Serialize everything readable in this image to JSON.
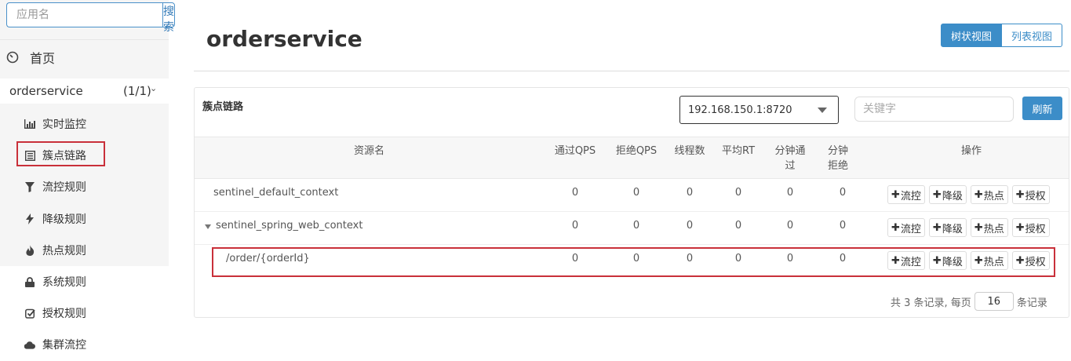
{
  "sidebar": {
    "search_placeholder": "应用名",
    "search_button": "搜索",
    "home_label": "首页",
    "app_name": "orderservice",
    "app_count": "(1/1)",
    "menu": [
      {
        "label": "实时监控",
        "icon": "bar-chart-icon"
      },
      {
        "label": "簇点链路",
        "icon": "list-icon"
      },
      {
        "label": "流控规则",
        "icon": "filter-icon"
      },
      {
        "label": "降级规则",
        "icon": "flash-icon"
      },
      {
        "label": "热点规则",
        "icon": "fire-icon"
      },
      {
        "label": "系统规则",
        "icon": "lock-icon"
      },
      {
        "label": "授权规则",
        "icon": "check-icon"
      },
      {
        "label": "集群流控",
        "icon": "cloud-icon"
      }
    ]
  },
  "header": {
    "title": "orderservice",
    "tree_view": "树状视图",
    "list_view": "列表视图"
  },
  "panel": {
    "title": "簇点链路",
    "machine": "192.168.150.1:8720",
    "keyword_placeholder": "关键字",
    "refresh": "刷新",
    "columns": {
      "resource": "资源名",
      "pass_qps": "通过QPS",
      "block_qps": "拒绝QPS",
      "threads": "线程数",
      "avg_rt": "平均RT",
      "minute_pass": "分钟通过",
      "minute_block": "分钟拒绝",
      "ops": "操作"
    },
    "ops": {
      "flow": "流控",
      "degrade": "降级",
      "hot": "热点",
      "auth": "授权"
    },
    "rows": [
      {
        "resource": "sentinel_default_context",
        "pass_qps": "0",
        "block_qps": "0",
        "threads": "0",
        "avg_rt": "0",
        "minute_pass": "0",
        "minute_block": "0"
      },
      {
        "resource": "sentinel_spring_web_context",
        "pass_qps": "0",
        "block_qps": "0",
        "threads": "0",
        "avg_rt": "0",
        "minute_pass": "0",
        "minute_block": "0"
      },
      {
        "resource": "/order/{orderId}",
        "pass_qps": "0",
        "block_qps": "0",
        "threads": "0",
        "avg_rt": "0",
        "minute_pass": "0",
        "minute_block": "0"
      }
    ],
    "pager": {
      "prefix": "共 3 条记录, 每页",
      "page_size": "16",
      "suffix": "条记录"
    }
  },
  "colors": {
    "accent": "#3c8dc8",
    "highlight": "#c9303a"
  }
}
